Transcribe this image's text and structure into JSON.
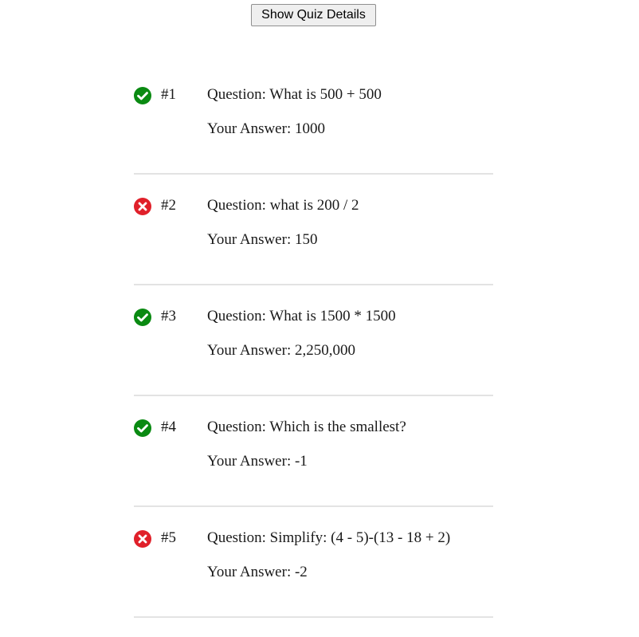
{
  "header": {
    "show_details_label": "Show Quiz Details"
  },
  "colors": {
    "correct": "#0a8a12",
    "incorrect": "#e0202a",
    "divider": "#e3e3e3"
  },
  "results": [
    {
      "number": "#1",
      "status": "correct",
      "icon": "check-circle-icon",
      "question": "Question: What is 500 + 500",
      "answer": "Your Answer: 1000"
    },
    {
      "number": "#2",
      "status": "incorrect",
      "icon": "x-circle-icon",
      "question": "Question: what is 200 / 2",
      "answer": "Your Answer: 150"
    },
    {
      "number": "#3",
      "status": "correct",
      "icon": "check-circle-icon",
      "question": "Question: What is 1500 * 1500",
      "answer": "Your Answer: 2,250,000"
    },
    {
      "number": "#4",
      "status": "correct",
      "icon": "check-circle-icon",
      "question": "Question: Which is the smallest?",
      "answer": "Your Answer: -1"
    },
    {
      "number": "#5",
      "status": "incorrect",
      "icon": "x-circle-icon",
      "question": "Question: Simplify: (4 - 5)-(13 - 18 + 2)",
      "answer": "Your Answer: -2"
    }
  ]
}
